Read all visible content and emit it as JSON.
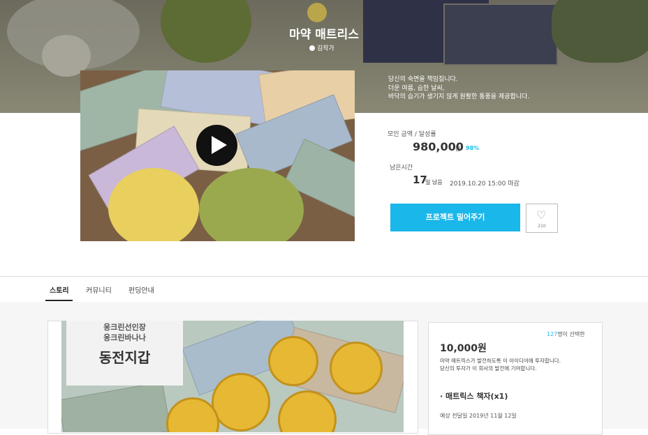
{
  "hero": {
    "title": "마약 매트리스",
    "author": "김작가",
    "description": [
      "당신의 숙면을 책임집니다.",
      "더운 여름, 습한 날씨,",
      "바닥의 습기가 생기지 않게 원활한 통풍을 제공합니다."
    ],
    "icons": {
      "author": "author-dot-icon"
    }
  },
  "stats": {
    "raised_label": "모인 금액 / 달성률",
    "raised_amount": "980,000",
    "raised_unit": "원",
    "percent": "98%",
    "remaining_label": "남은시간",
    "days": "17",
    "days_unit": "일 남음",
    "deadline": "2019.10.20  15:00  마감"
  },
  "actions": {
    "support_button": "프로젝트 밀어주기",
    "like_count": "210",
    "like_icon": "heart-icon"
  },
  "tabs": [
    {
      "label": "스토리",
      "active": true
    },
    {
      "label": "커뮤니티",
      "active": false
    },
    {
      "label": "펀딩안내",
      "active": false
    }
  ],
  "story": {
    "subtitle_lines": [
      "웅크린선인장",
      "웅크린바나나"
    ],
    "title": "동전지갑"
  },
  "reward": {
    "selected_count": "127",
    "selected_suffix": "명이 선택한",
    "price": "10,000원",
    "description": [
      "마약 매트릭스가 발전하도록 이 아이디어에 투자합니다.",
      "당신의 투자가 이 회사의 발전에 기여합니다."
    ],
    "item": "· 매트릭스 책자(x1)",
    "shipping": "예상 전달일 2019년 11월 12일"
  },
  "colors": {
    "accent": "#1ab7ea",
    "text": "#333333"
  }
}
